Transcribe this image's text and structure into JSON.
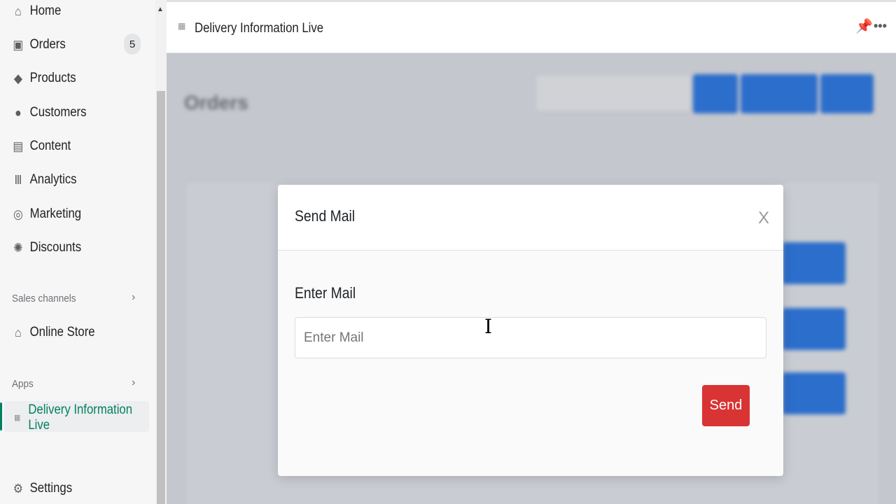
{
  "sidebar": {
    "items": [
      {
        "label": "Home",
        "icon": "home-icon"
      },
      {
        "label": "Orders",
        "icon": "orders-icon",
        "badge": "5"
      },
      {
        "label": "Products",
        "icon": "tag-icon"
      },
      {
        "label": "Customers",
        "icon": "person-icon"
      },
      {
        "label": "Content",
        "icon": "content-icon"
      },
      {
        "label": "Analytics",
        "icon": "bar-chart-icon"
      },
      {
        "label": "Marketing",
        "icon": "target-icon"
      },
      {
        "label": "Discounts",
        "icon": "discount-icon"
      }
    ],
    "sales_channels": "Sales channels",
    "online_store": "Online Store",
    "apps": "Apps",
    "active_app": "Delivery Information Live",
    "settings": "Settings"
  },
  "header": {
    "title": "Delivery Information Live"
  },
  "background": {
    "page_title": "Orders"
  },
  "modal": {
    "title": "Send Mail",
    "close": "X",
    "field_label": "Enter Mail",
    "field_placeholder": "Enter Mail",
    "field_value": "",
    "send": "Send"
  },
  "colors": {
    "accent": "#008060",
    "send": "#d93434",
    "primary_blurred": "#2c6ecb"
  }
}
